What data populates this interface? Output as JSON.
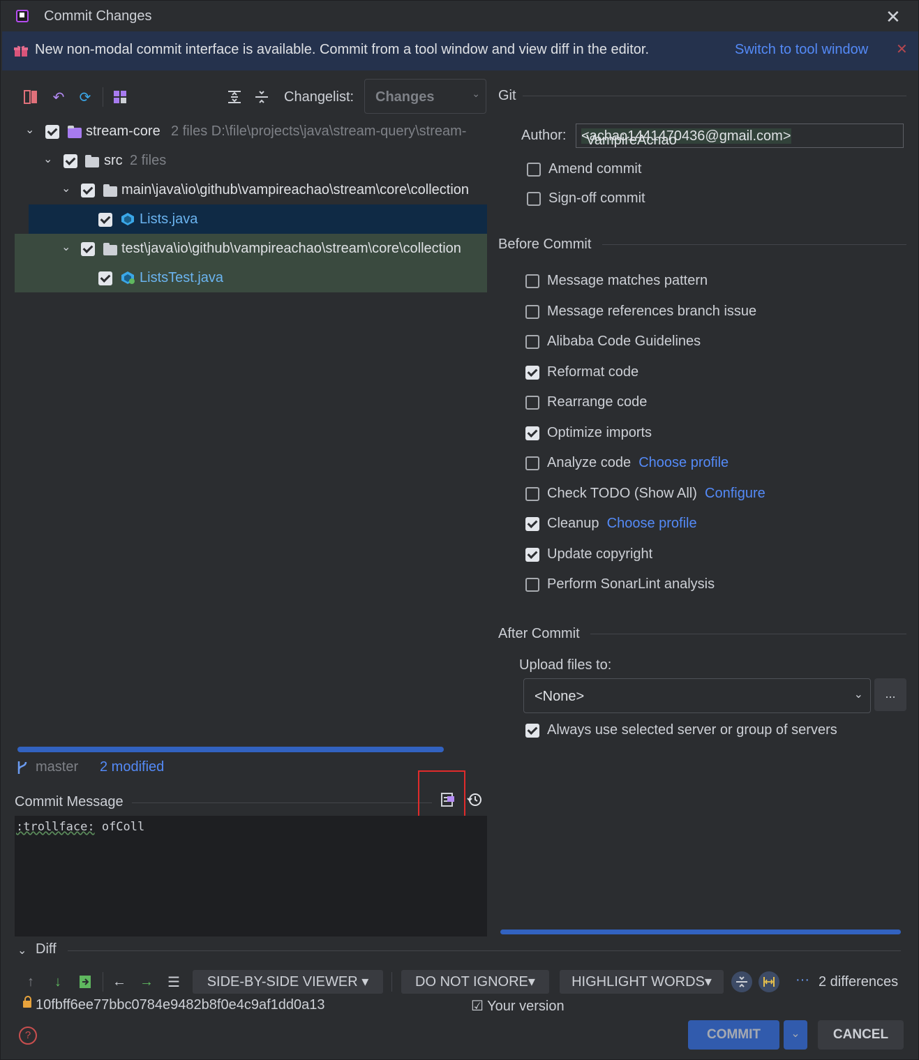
{
  "window": {
    "title": "Commit Changes"
  },
  "banner": {
    "text": "New non-modal commit interface is available. Commit from a tool window and view diff in the editor.",
    "link": "Switch to tool window"
  },
  "toolbar": {
    "changelist_label": "Changelist:",
    "changelist_value": "Changes"
  },
  "tree": {
    "rows": [
      {
        "name": "stream-core",
        "meta": "2 files  D:\\file\\projects\\java\\stream-query\\stream-"
      },
      {
        "name": "src",
        "meta": "2 files"
      },
      {
        "name": "main\\java\\io\\github\\vampireachao\\stream\\core\\collection"
      },
      {
        "name": "Lists.java"
      },
      {
        "name": "test\\java\\io\\github\\vampireachao\\stream\\core\\collection"
      },
      {
        "name": "ListsTest.java"
      }
    ]
  },
  "status": {
    "branch": "master",
    "modified": "2 modified"
  },
  "commit_message": {
    "label": "Commit Message",
    "emoji": ":trollface:",
    "rest": " ofColl"
  },
  "git": {
    "section_title": "Git",
    "author_label": "Author:",
    "author_name": "VampireAchao ",
    "author_email": "<achao1441470436@gmail.com>",
    "amend": "Amend commit",
    "signoff": "Sign-off commit"
  },
  "before_commit": {
    "title": "Before Commit",
    "items": [
      {
        "label": "Message matches pattern",
        "checked": false
      },
      {
        "label": "Message references branch issue",
        "checked": false
      },
      {
        "label": "Alibaba Code Guidelines",
        "checked": false
      },
      {
        "label": "Reformat code",
        "checked": true
      },
      {
        "label": "Rearrange code",
        "checked": false
      },
      {
        "label": "Optimize imports",
        "checked": true
      },
      {
        "label": "Analyze code",
        "checked": false,
        "link": "Choose profile"
      },
      {
        "label": "Check TODO (Show All)",
        "checked": false,
        "link": "Configure"
      },
      {
        "label": "Cleanup",
        "checked": true,
        "link": "Choose profile"
      },
      {
        "label": "Update copyright",
        "checked": true
      },
      {
        "label": "Perform SonarLint analysis",
        "checked": false
      }
    ]
  },
  "after_commit": {
    "title": "After Commit",
    "upload_label": "Upload files to:",
    "upload_value": "<None>",
    "more": "...",
    "always_use": "Always use selected server or group of servers"
  },
  "diff": {
    "label": "Diff",
    "viewer": "SIDE-BY-SIDE VIEWER",
    "ignore": "DO NOT IGNORE",
    "highlight": "HIGHLIGHT WORDS",
    "more": "···",
    "count": "2 differences",
    "hash": "10fbff6ee77bbc0784e9482b8f0e4c9af1dd0a13",
    "your_version": "Your version"
  },
  "buttons": {
    "commit": "COMMIT",
    "cancel": "CANCEL",
    "help": "?"
  },
  "colors": {
    "accent": "#3574f0",
    "link": "#548af7",
    "selection": "#0f2a45",
    "test_bg": "#3a4a3f",
    "highlight_box": "#e02b2b"
  }
}
